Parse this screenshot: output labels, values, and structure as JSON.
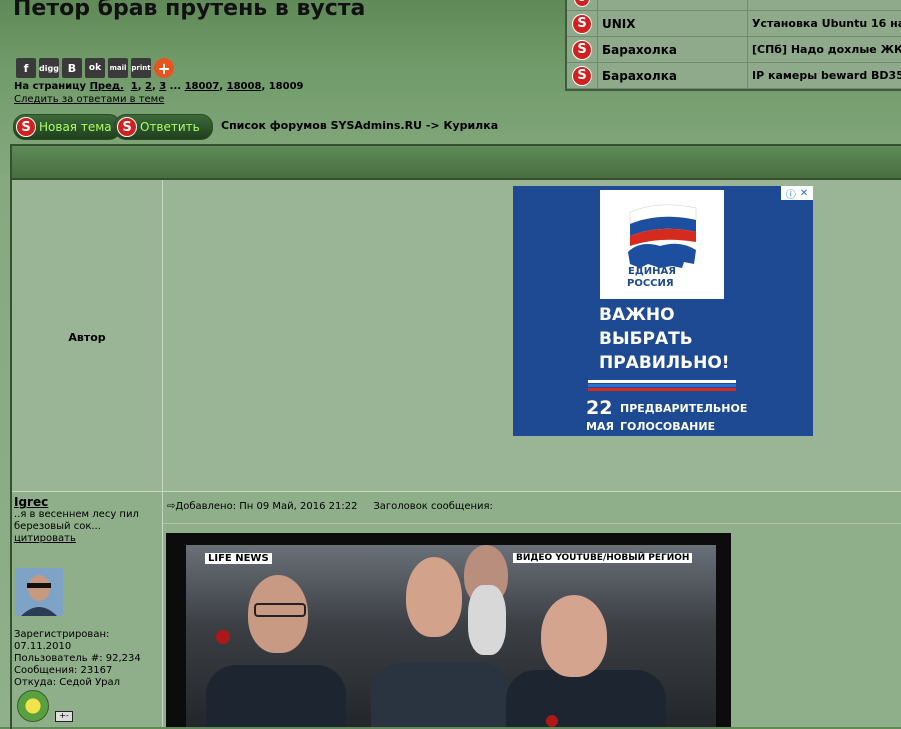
{
  "page": {
    "title": "Петор брав прутень в вуста",
    "breadcrumb": "Список форумов SYSAdmins.RU -> Курилка",
    "watch_link": "Следить за ответами в теме"
  },
  "share": [
    "f",
    "digg",
    "B",
    "ok",
    "mail",
    "print",
    "+"
  ],
  "pager": {
    "prefix": "На страницу",
    "prev": "Пред.",
    "p1": "1",
    "p2": "2",
    "p3": "3",
    "ellipsis": "...",
    "p4": "18007",
    "p5": "18008",
    "current": "18009"
  },
  "buttons": {
    "new_topic": "Новая тема",
    "reply": "Ответить"
  },
  "recent_topics": [
    {
      "forum": "UNIX",
      "topic": "Установка Ubuntu 16 на"
    },
    {
      "forum": "Барахолка",
      "topic": "[СПб] Надо дохлые ЖК-"
    },
    {
      "forum": "Барахолка",
      "topic": "IP камеры beward BD35"
    }
  ],
  "table": {
    "author_header": "Автор"
  },
  "ad": {
    "logo_line1": "ЕДИНАЯ",
    "logo_line2": "РОССИЯ",
    "headline1": "ВАЖНО",
    "headline2": "ВЫБРАТЬ",
    "headline3": "ПРАВИЛЬНО!",
    "date_num": "22",
    "date_month": "МАЯ",
    "footer1": "ПРЕДВАРИТЕЛЬНОЕ",
    "footer2": "ГОЛОСОВАНИЕ"
  },
  "post": {
    "username": "Igrec",
    "signature": "..я в весеннем лесу пил березовый сок...",
    "quote": "цитировать",
    "registered_label": "Зарегистрирован:",
    "registered": "07.11.2010",
    "user_no": "Пользователь #: 92,234",
    "messages": "Сообщения: 23167",
    "from": "Откуда: Седой Урал",
    "added": "Добавлено: Пн 09 Май, 2016 21:22",
    "subject_label": "Заголовок сообщения:"
  },
  "video": {
    "channel": "LIFE NEWS",
    "credit": "ВИДЕО YOUTUBE/НОВЫЙ РЕГИОН"
  }
}
